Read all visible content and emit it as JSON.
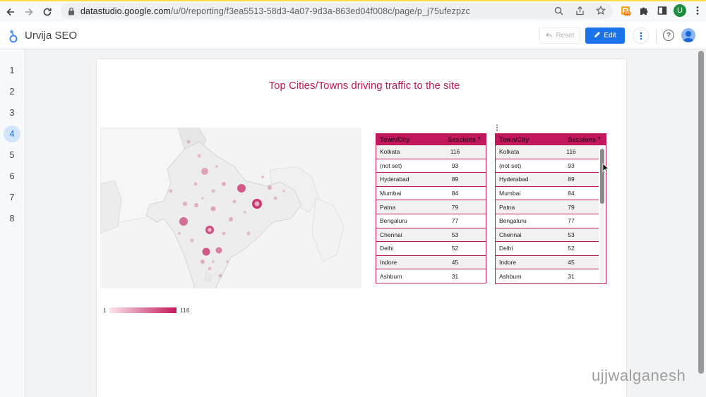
{
  "browser": {
    "url_host": "datastudio.google.com",
    "url_path": "/u/0/reporting/f3ea5513-58d3-4a07-9d3a-863ed04f008c/page/p_j75ufezpzc",
    "extension_badge": "86",
    "profile_initial": "U"
  },
  "header": {
    "title": "Urvija SEO",
    "reset_label": "Reset",
    "edit_label": "Edit"
  },
  "pages": [
    "1",
    "2",
    "3",
    "4",
    "5",
    "6",
    "7",
    "8"
  ],
  "active_page": "4",
  "report": {
    "title": "Top Cities/Towns driving traffic to the site",
    "legend_min": "1",
    "legend_max": "116"
  },
  "table": {
    "col_city": "Town/City",
    "col_sessions": "Sessions",
    "rows": [
      {
        "city": "Kolkata",
        "sessions": "116"
      },
      {
        "city": "(not set)",
        "sessions": "93"
      },
      {
        "city": "Hyderabad",
        "sessions": "89"
      },
      {
        "city": "Mumbai",
        "sessions": "84"
      },
      {
        "city": "Patna",
        "sessions": "79"
      },
      {
        "city": "Bengaluru",
        "sessions": "77"
      },
      {
        "city": "Chennai",
        "sessions": "53"
      },
      {
        "city": "Delhi",
        "sessions": "52"
      },
      {
        "city": "Indore",
        "sessions": "45"
      },
      {
        "city": "Ashburn",
        "sessions": "31"
      }
    ]
  },
  "colors": {
    "accent": "#c2185b",
    "button_blue": "#1a73e8"
  },
  "watermark": "ujjwalganesh"
}
